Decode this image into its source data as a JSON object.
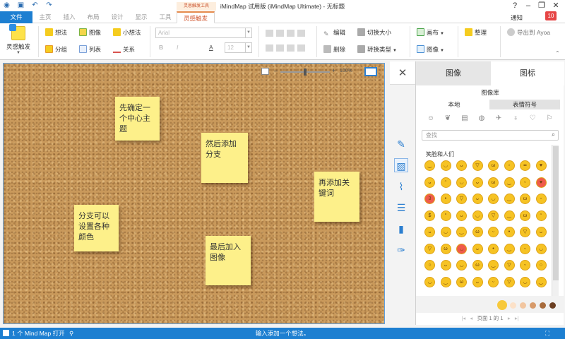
{
  "window": {
    "title": "iMindMap 试用版 (iMindMap Ultimate) - 无标题",
    "help": "?",
    "minimize": "–",
    "restore": "❐",
    "close": "✕",
    "notify_label": "通知",
    "notify_count": "10"
  },
  "context_tab_label": "灵思触发工具",
  "tabs": [
    "文件",
    "主页",
    "插入",
    "布局",
    "设计",
    "显示",
    "工具",
    "灵感触发"
  ],
  "ribbon": {
    "big_button": "灵感触发",
    "idea": "想法",
    "image": "图像",
    "small_idea": "小想法",
    "group": "分组",
    "list": "列表",
    "relation": "关系",
    "font_placeholder": "Arial",
    "font_size": "12",
    "bold": "B",
    "italic": "I",
    "underline": "A",
    "edit": "编辑",
    "delete": "删除",
    "toggle_size": "切换大小",
    "convert_type": "转换类型",
    "canvas": "画布",
    "image2": "图像",
    "tidy": "整理",
    "export_ayoa": "导出到 Ayoa"
  },
  "canvas": {
    "zoom_percent": "100%",
    "notes": [
      {
        "text": "先确定一个中心主题"
      },
      {
        "text": "然后添加分支"
      },
      {
        "text": "再添加关键词"
      },
      {
        "text": "分支可以设置各种颜色"
      },
      {
        "text": "最后加入图像"
      }
    ]
  },
  "panel": {
    "tab_images": "图像",
    "tab_icons": "图标",
    "library_label": "图像库",
    "sub_local": "本地",
    "sub_emoji": "表情符号",
    "search_placeholder": "查找",
    "section_title": "笑脸和人们",
    "pager": "页面 1 的 1"
  },
  "status": {
    "left": "1 个 Mind Map 打开",
    "center": "输入添加一个想法。"
  }
}
